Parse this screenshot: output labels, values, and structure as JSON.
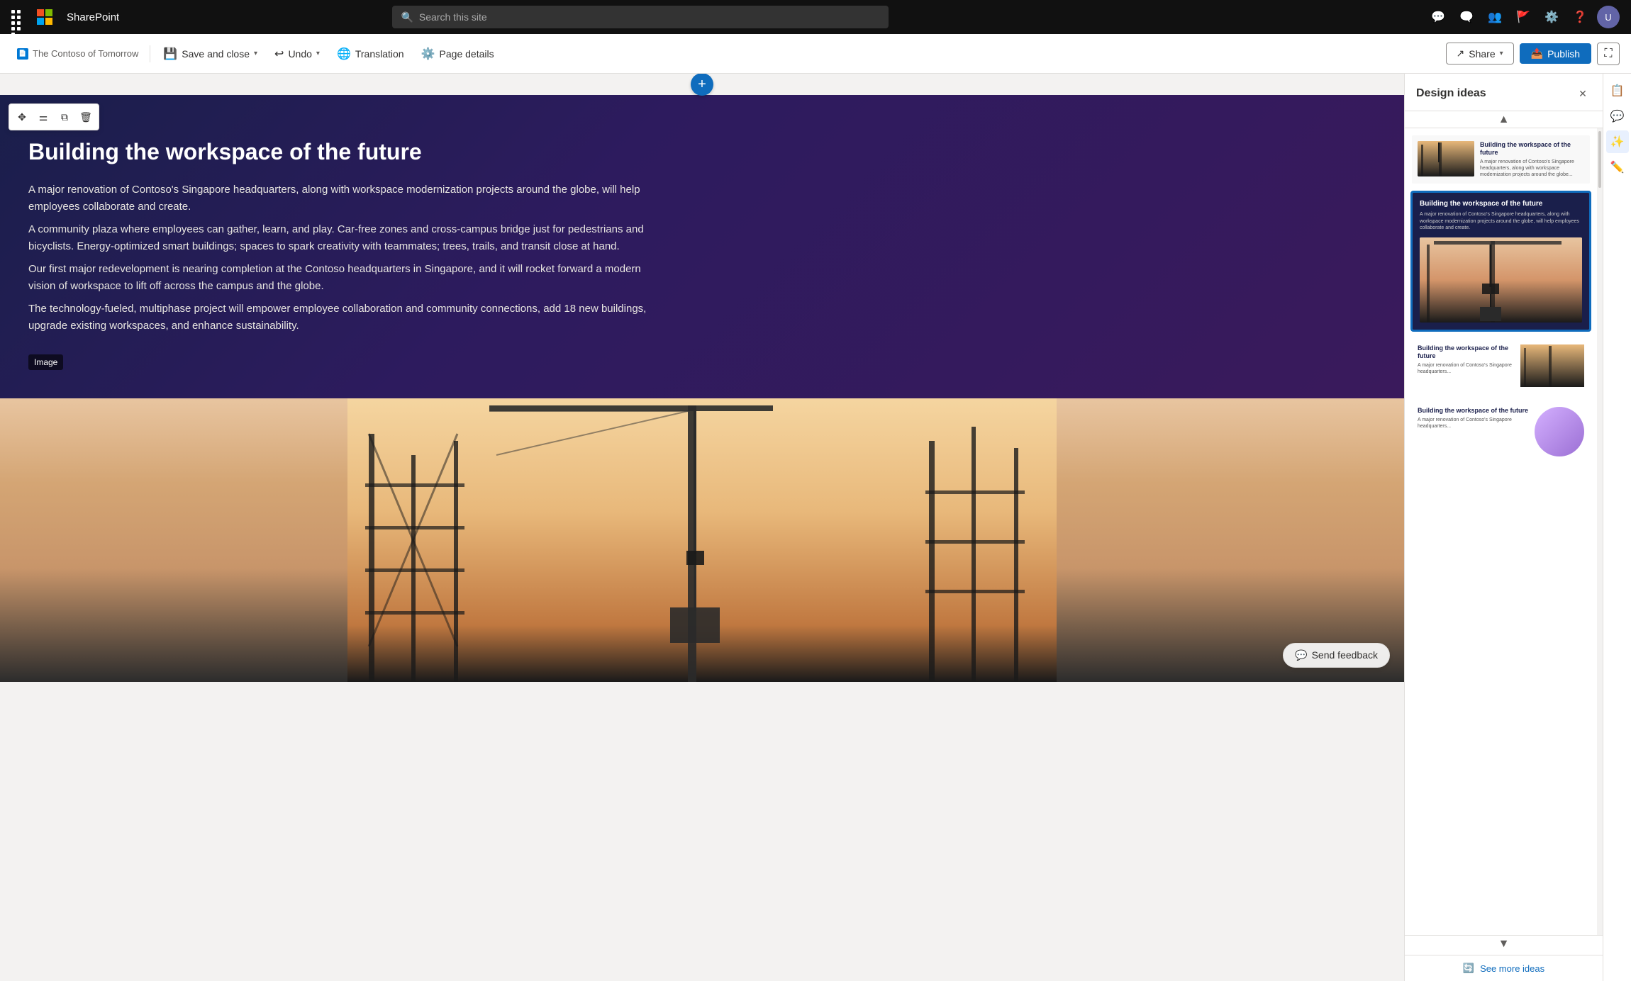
{
  "nav": {
    "app_name": "SharePoint",
    "search_placeholder": "Search this site",
    "icons": [
      "question-circle",
      "settings",
      "people",
      "flag",
      "chat",
      "feedback"
    ]
  },
  "toolbar": {
    "page_label": "The Contoso of Tomorrow",
    "save_close_label": "Save and close",
    "undo_label": "Undo",
    "translation_label": "Translation",
    "page_details_label": "Page details",
    "share_label": "Share",
    "publish_label": "Publish"
  },
  "hero": {
    "title": "Building the workspace of the future",
    "paragraphs": [
      "A major renovation of Contoso's Singapore headquarters, along with workspace modernization projects around the globe, will help employees collaborate and create.",
      "A community plaza where employees can gather, learn, and play. Car-free zones and cross-campus bridge just for pedestrians and bicyclists. Energy-optimized smart buildings; spaces to spark creativity with teammates; trees, trails, and transit close at hand.",
      "Our first major redevelopment is nearing completion at the Contoso headquarters in Singapore, and it will rocket forward a modern vision of workspace to lift off across the campus and the globe.",
      "The technology-fueled, multiphase project will empower employee collaboration and community connections, add 18 new buildings, upgrade existing workspaces, and enhance sustainability."
    ],
    "image_label": "Image"
  },
  "design_panel": {
    "title": "Design ideas",
    "card1": {
      "title": "Building the workspace of the future",
      "body": "A major renovation of Contoso's Singapore headquarters, along with workspace modernization projects around the globe..."
    },
    "card2": {
      "title": "Building the workspace of the future",
      "body": "A major renovation of Contoso's Singapore headquarters, along with workspace modernization projects around the globe, will help employees collaborate and create."
    },
    "card3": {
      "title": "Building the workspace of the future",
      "body": "A major renovation of Contoso's Singapore headquarters..."
    },
    "card4": {
      "title": "Building the workspace of the future",
      "body": "A major renovation of Contoso's Singapore headquarters..."
    },
    "see_more_label": "See more ideas"
  },
  "feedback": {
    "label": "Send feedback"
  }
}
